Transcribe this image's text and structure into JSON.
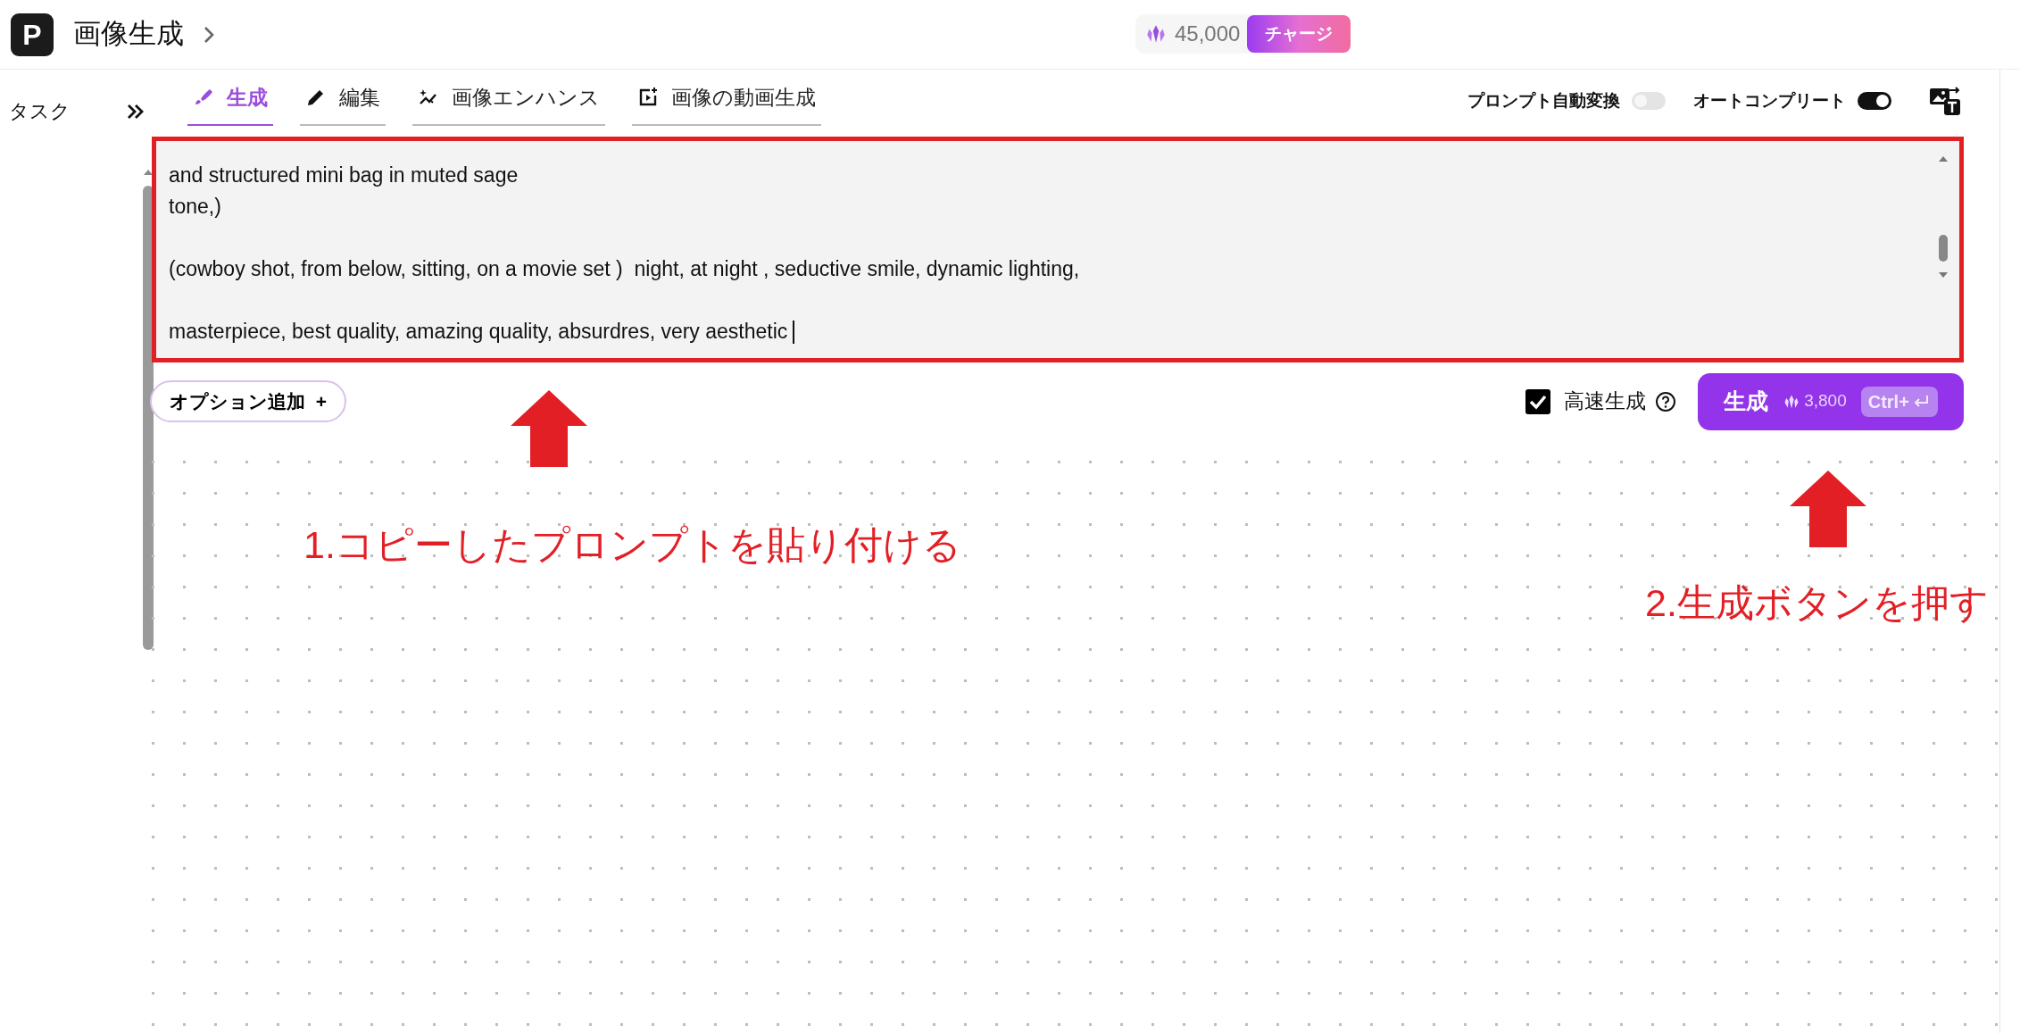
{
  "header": {
    "logo": "P",
    "title": "画像生成",
    "credits": "45,000",
    "charge_button": "チャージ"
  },
  "sidebar": {
    "label": "タスク"
  },
  "tabs": [
    {
      "label": "生成",
      "kind": "brush",
      "selected": true
    },
    {
      "label": "編集",
      "kind": "pencil",
      "selected": false
    },
    {
      "label": "画像エンハンス",
      "kind": "enhance",
      "selected": false
    },
    {
      "label": "画像の動画生成",
      "kind": "video",
      "selected": false
    }
  ],
  "toggles": [
    {
      "label": "プロンプト自動変換",
      "on": false
    },
    {
      "label": "オートコンプリート",
      "on": true
    }
  ],
  "prompt": {
    "paragraphs": [
      [
        "and structured mini bag in muted sage",
        "tone,)"
      ],
      [
        "(cowboy shot, from below, sitting, on a movie set )  night, at night , seductive smile, dynamic lighting,"
      ],
      [
        "masterpiece, best quality, amazing quality, absurdres, very aesthetic"
      ]
    ]
  },
  "options_button": {
    "label": "オプション追加",
    "symbol": "+"
  },
  "fast_generation": {
    "label": "高速生成",
    "checked": true
  },
  "generate_button": {
    "label": "生成",
    "cost": "3,800",
    "shortcut": "Ctrl+"
  },
  "annotations": [
    {
      "text": "1.コピーしたプロンプトを貼り付ける"
    },
    {
      "text": "2.生成ボタンを押す"
    }
  ]
}
